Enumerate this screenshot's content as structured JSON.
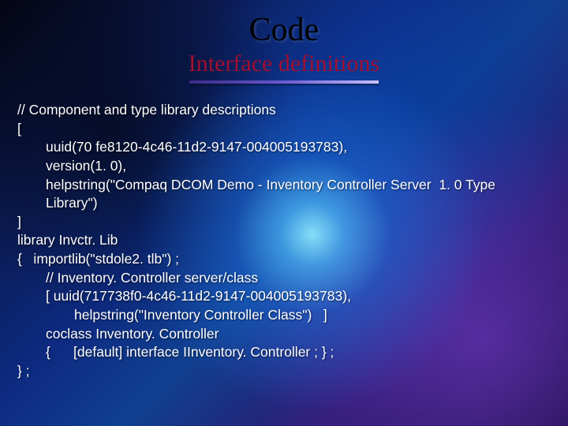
{
  "title": "Code",
  "subtitle": "Interface definitions",
  "code": {
    "l1": "// Component and type library descriptions",
    "l2": "[",
    "l3": "uuid(70 fe8120-4c46-11d2-9147-004005193783),",
    "l4": "version(1. 0),",
    "l5": "helpstring(\"Compaq DCOM Demo - Inventory Controller Server  1. 0 Type Library\")",
    "l6": "]",
    "l7": "library Invctr. Lib",
    "l8": "{   importlib(\"stdole2. tlb\") ;",
    "l9": "// Inventory. Controller server/class",
    "l10": "[ uuid(717738f0-4c46-11d2-9147-004005193783),",
    "l11": "helpstring(\"Inventory Controller Class\")   ]",
    "l12": "coclass Inventory. Controller",
    "l13": "{      [default] interface IInventory. Controller ; } ;",
    "l14": "} ;"
  }
}
